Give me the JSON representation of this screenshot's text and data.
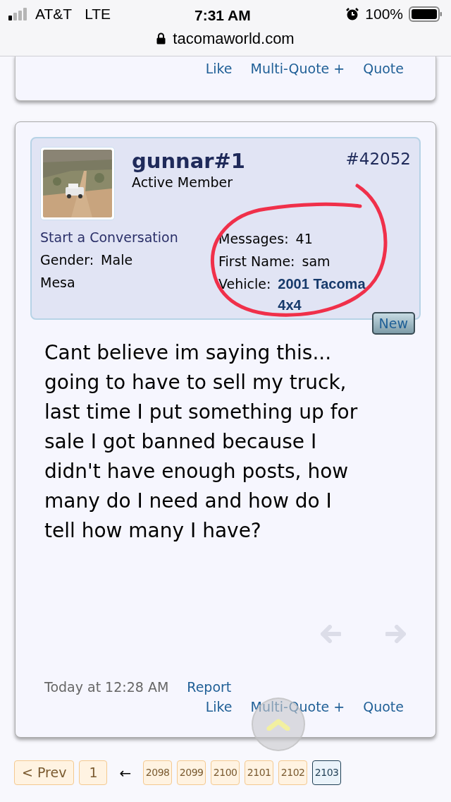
{
  "status_bar": {
    "carrier": "AT&T",
    "network": "LTE",
    "time": "7:31 AM",
    "battery": "100%"
  },
  "address_bar": {
    "url": "tacomaworld.com"
  },
  "previous_post": {
    "actions": [
      "Like",
      "Multi-Quote +",
      "Quote"
    ]
  },
  "post": {
    "username": "gunnar#1",
    "user_title": "Active Member",
    "post_number": "#42052",
    "start_conversation": "Start a Conversation",
    "left_fields": [
      {
        "label": "Gender:",
        "value": "Male"
      },
      {
        "value": "Mesa"
      }
    ],
    "right_fields": [
      {
        "label": "Messages:",
        "value": "41",
        "kind": "plain"
      },
      {
        "label": "First Name:",
        "value": "sam",
        "kind": "plain"
      },
      {
        "label": "Vehicle:",
        "value": "2001 Tacoma 4x4",
        "kind": "bold"
      }
    ],
    "new_badge": "New",
    "message": "Cant believe im saying this... going to have to sell my truck, last time I put something up for sale I got banned because I didn't have enough posts, how many do I need and how do I tell how many I have?",
    "date": "Today at 12:28 AM",
    "report": "Report",
    "actions": [
      "Like",
      "Multi-Quote +",
      "Quote"
    ]
  },
  "pagination": {
    "prev": "< Prev",
    "first": "1",
    "gap": "←",
    "pages": [
      {
        "label": "2098",
        "selected": false
      },
      {
        "label": "2099",
        "selected": false
      },
      {
        "label": "2100",
        "selected": false
      },
      {
        "label": "2101",
        "selected": false
      },
      {
        "label": "2102",
        "selected": false
      },
      {
        "label": "2103",
        "selected": true
      }
    ]
  }
}
